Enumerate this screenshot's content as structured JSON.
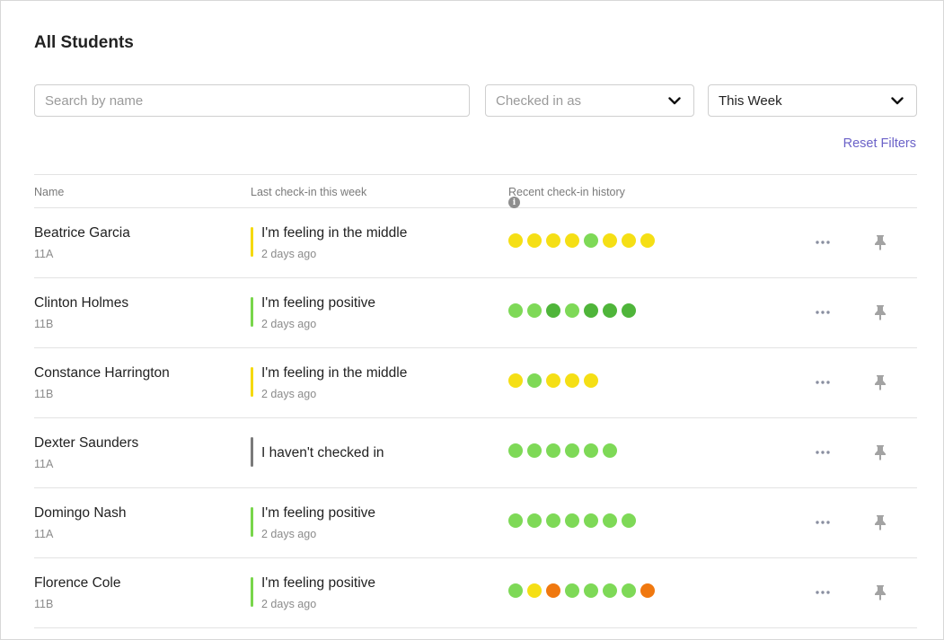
{
  "page": {
    "title": "All Students"
  },
  "filters": {
    "search_placeholder": "Search by name",
    "checked_in_as": "Checked in as",
    "period": "This Week",
    "reset_label": "Reset Filters"
  },
  "table": {
    "headers": {
      "name": "Name",
      "last_checkin": "Last check-in this week",
      "history": "Recent check-in history"
    },
    "rows": [
      {
        "name": "Beatrice Garcia",
        "class": "11A",
        "status": "I'm feeling in the middle",
        "ago": "2 days ago",
        "bar": "#f5d90a",
        "history": [
          "#f5df15",
          "#f5df15",
          "#f5df15",
          "#f5df15",
          "#7ed957",
          "#f5df15",
          "#f5df15",
          "#f5df15"
        ]
      },
      {
        "name": "Clinton Holmes",
        "class": "11B",
        "status": "I'm feeling positive",
        "ago": "2 days ago",
        "bar": "#78d64b",
        "history": [
          "#7ed957",
          "#7ed957",
          "#4fb53a",
          "#7ed957",
          "#4fb53a",
          "#4fb53a",
          "#4fb53a"
        ]
      },
      {
        "name": "Constance Harrington",
        "class": "11B",
        "status": "I'm feeling in the middle",
        "ago": "2 days ago",
        "bar": "#f5d90a",
        "history": [
          "#f5df15",
          "#7ed957",
          "#f5df15",
          "#f5df15",
          "#f5df15"
        ]
      },
      {
        "name": "Dexter Saunders",
        "class": "11A",
        "status": "I haven't checked in",
        "ago": "",
        "bar": "#7a7a7a",
        "history": [
          "#7ed957",
          "#7ed957",
          "#7ed957",
          "#7ed957",
          "#7ed957",
          "#7ed957"
        ]
      },
      {
        "name": "Domingo Nash",
        "class": "11A",
        "status": "I'm feeling positive",
        "ago": "2 days ago",
        "bar": "#78d64b",
        "history": [
          "#7ed957",
          "#7ed957",
          "#7ed957",
          "#7ed957",
          "#7ed957",
          "#7ed957",
          "#7ed957"
        ]
      },
      {
        "name": "Florence Cole",
        "class": "11B",
        "status": "I'm feeling positive",
        "ago": "2 days ago",
        "bar": "#78d64b",
        "history": [
          "#7ed957",
          "#f5df15",
          "#f0780f",
          "#7ed957",
          "#7ed957",
          "#7ed957",
          "#7ed957",
          "#f0780f"
        ]
      }
    ]
  },
  "icons": {
    "more": "more-horizontal-icon",
    "pin": "pin-icon",
    "info": "info-icon",
    "dropdown": "chevron-down-icon"
  }
}
